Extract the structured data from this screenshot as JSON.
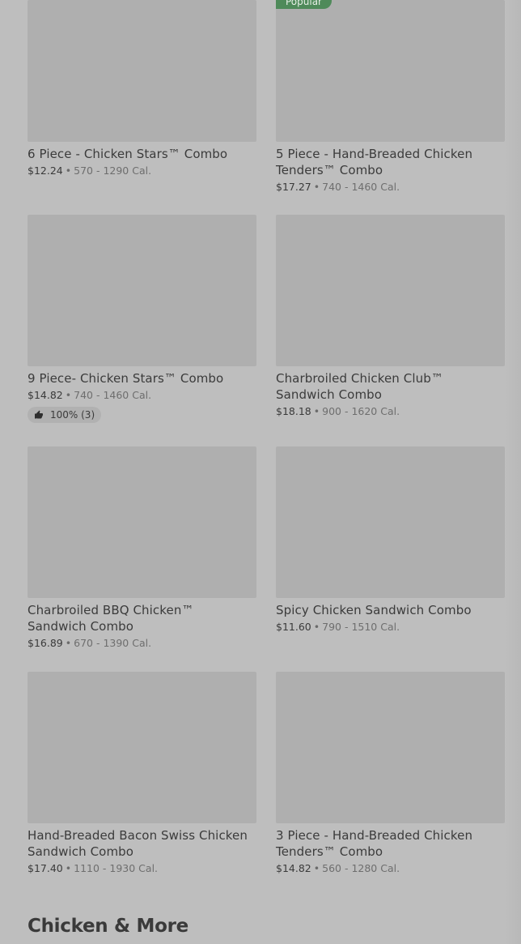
{
  "items": [
    {
      "title": "6 Piece - Chicken Stars™ Combo",
      "price": "$12.24",
      "calories": "570 - 1290 Cal."
    },
    {
      "title": "5 Piece - Hand-Breaded Chicken Tenders™  Combo",
      "price": "$17.27",
      "calories": "740 - 1460 Cal.",
      "badge": "Popular"
    },
    {
      "title": "9 Piece- Chicken Stars™ Combo",
      "price": "$14.82",
      "calories": "740 - 1460 Cal.",
      "rating": "100% (3)"
    },
    {
      "title": "Charbroiled Chicken Club™ Sandwich Combo",
      "price": "$18.18",
      "calories": "900 - 1620 Cal."
    },
    {
      "title": "Charbroiled BBQ Chicken™ Sandwich Combo",
      "price": "$16.89",
      "calories": "670 - 1390 Cal."
    },
    {
      "title": "Spicy Chicken Sandwich Combo",
      "price": "$11.60",
      "calories": "790 - 1510 Cal."
    },
    {
      "title": "Hand-Breaded Bacon Swiss Chicken Sandwich Combo",
      "price": "$17.40",
      "calories": "1110 - 1930 Cal."
    },
    {
      "title": "3 Piece - Hand-Breaded Chicken Tenders™ Combo",
      "price": "$14.82",
      "calories": "560 - 1280 Cal."
    }
  ],
  "meta_separator": "•",
  "section": {
    "title": "Chicken & More"
  },
  "colors": {
    "background": "#bebebe",
    "image_placeholder": "#afafaf",
    "popular_badge": "#4f8a5a"
  },
  "icons": {
    "rating": "thumbs-up-icon"
  }
}
